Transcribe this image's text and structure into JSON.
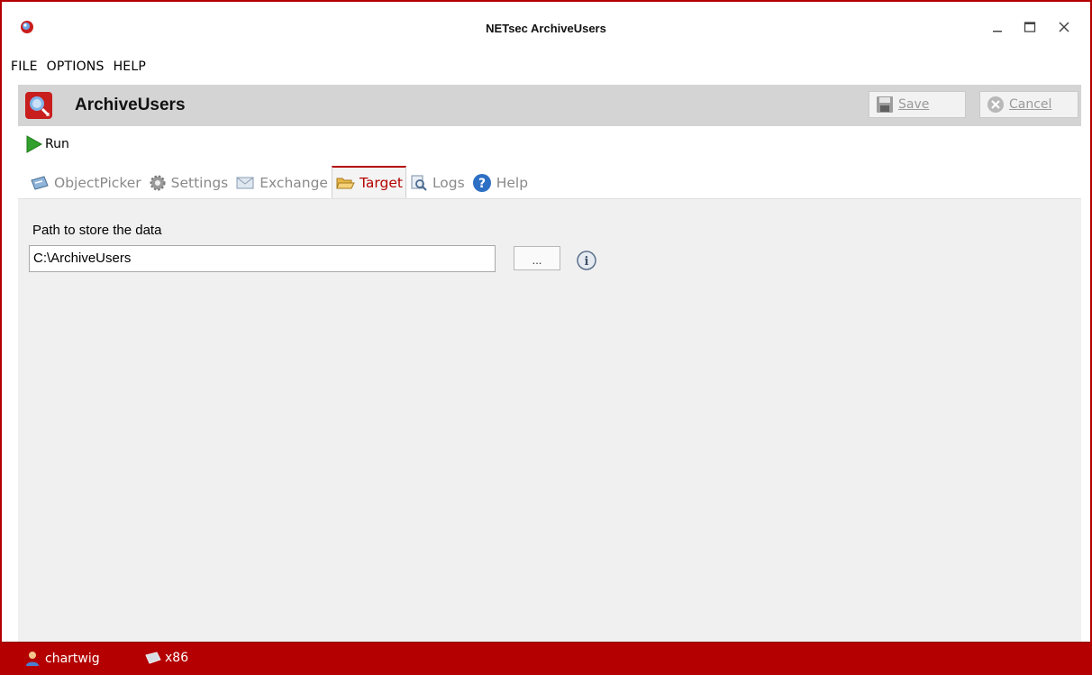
{
  "window": {
    "title": "NETsec ArchiveUsers",
    "icons": {
      "app": "app-logo-icon",
      "minimize": "minimize-icon",
      "maximize": "maximize-icon",
      "close": "close-icon"
    },
    "accent_color": "#b40000"
  },
  "menu": {
    "items": [
      "FILE",
      "OPTIONS",
      "HELP"
    ]
  },
  "header": {
    "title": "ArchiveUsers",
    "save_label": "Save",
    "cancel_label": "Cancel",
    "save_enabled": false,
    "cancel_enabled": false
  },
  "toolbar": {
    "run_label": "Run"
  },
  "tabs": [
    {
      "label": "ObjectPicker",
      "icon": "object-picker-icon",
      "active": false
    },
    {
      "label": "Settings",
      "icon": "gear-icon",
      "active": false
    },
    {
      "label": "Exchange",
      "icon": "envelope-icon",
      "active": false
    },
    {
      "label": "Target",
      "icon": "folder-open-icon",
      "active": true
    },
    {
      "label": "Logs",
      "icon": "log-search-icon",
      "active": false
    },
    {
      "label": "Help",
      "icon": "help-icon",
      "active": false
    }
  ],
  "target": {
    "path_label": "Path to store the data",
    "path_value": "C:\\ArchiveUsers",
    "browse_label": "...",
    "info_icon": "info-icon"
  },
  "status": {
    "user": "chartwig",
    "arch": "x86"
  }
}
